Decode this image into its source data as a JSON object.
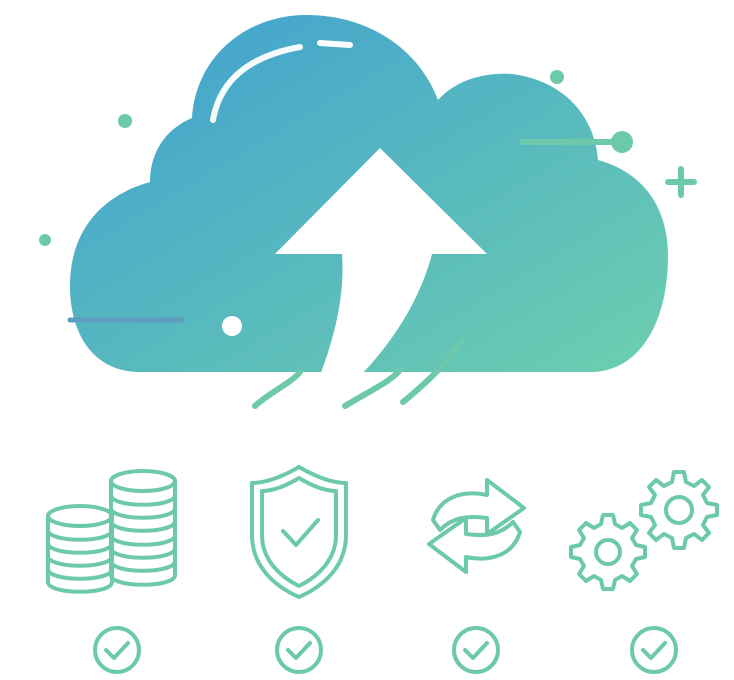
{
  "colors": {
    "cloud_gradient_start": "#3f9fd2",
    "cloud_gradient_end": "#6dcfae",
    "icon_stroke": "#6cc9a9",
    "highlight": "#ffffff",
    "background": "#ffffff"
  },
  "hero": {
    "icon": "cloud-upload-icon"
  },
  "features": [
    {
      "icon": "coin-stack-icon",
      "status_icon": "check-circle-icon"
    },
    {
      "icon": "shield-check-icon",
      "status_icon": "check-circle-icon"
    },
    {
      "icon": "sync-arrows-icon",
      "status_icon": "check-circle-icon"
    },
    {
      "icon": "gears-icon",
      "status_icon": "check-circle-icon"
    }
  ]
}
